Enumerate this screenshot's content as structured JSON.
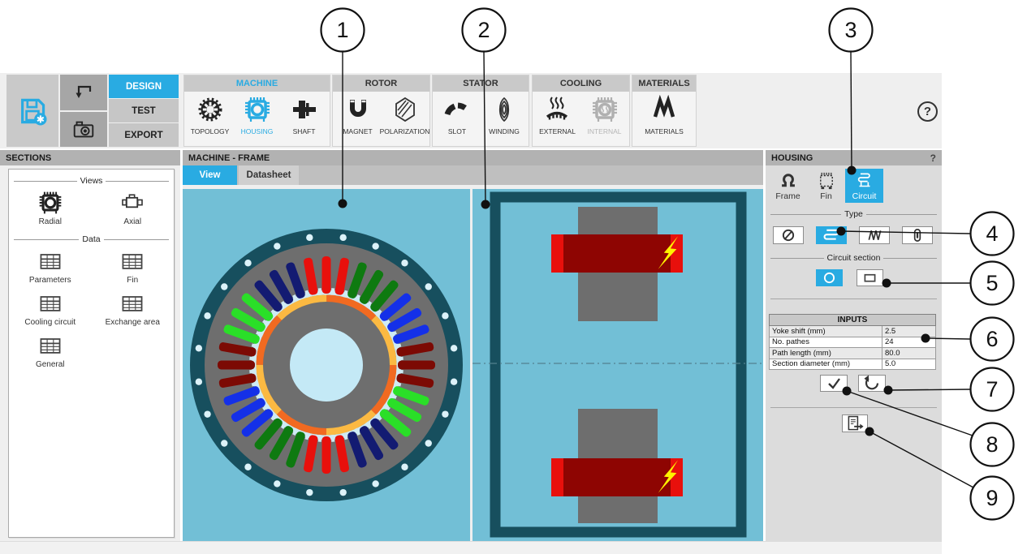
{
  "app": {
    "quick_buttons": [
      {
        "icon": "save-icon"
      },
      {
        "icon": "undo-arrow-icon"
      },
      {
        "icon": "camera-icon"
      }
    ],
    "help_label": "?"
  },
  "ribbon": {
    "file_tabs": [
      {
        "label": "DESIGN",
        "active": true
      },
      {
        "label": "TEST",
        "active": false
      },
      {
        "label": "EXPORT",
        "active": false
      }
    ],
    "groups": [
      {
        "label": "MACHINE",
        "active": true,
        "items": [
          {
            "label": "TOPOLOGY",
            "icon": "topology-icon"
          },
          {
            "label": "HOUSING",
            "icon": "housing-icon",
            "active": true
          },
          {
            "label": "SHAFT",
            "icon": "shaft-icon"
          }
        ]
      },
      {
        "label": "ROTOR",
        "items": [
          {
            "label": "MAGNET",
            "icon": "magnet-icon"
          },
          {
            "label": "POLARIZATION",
            "icon": "polarization-icon"
          }
        ]
      },
      {
        "label": "STATOR",
        "items": [
          {
            "label": "SLOT",
            "icon": "slot-icon"
          },
          {
            "label": "WINDING",
            "icon": "winding-icon"
          }
        ]
      },
      {
        "label": "COOLING",
        "items": [
          {
            "label": "EXTERNAL",
            "icon": "external-cooling-icon"
          },
          {
            "label": "INTERNAL",
            "icon": "internal-cooling-icon",
            "disabled": true
          }
        ]
      },
      {
        "label": "MATERIALS",
        "items": [
          {
            "label": "MATERIALS",
            "icon": "materials-icon"
          }
        ]
      }
    ]
  },
  "sections_panel": {
    "title": "SECTIONS",
    "views_divider": "Views",
    "data_divider": "Data",
    "views": [
      {
        "label": "Radial",
        "icon": "radial-view-icon"
      },
      {
        "label": "Axial",
        "icon": "axial-view-icon"
      }
    ],
    "data_items": [
      {
        "label": "Parameters",
        "icon": "table-icon"
      },
      {
        "label": "Fin",
        "icon": "table-icon"
      },
      {
        "label": "Cooling circuit",
        "icon": "table-icon"
      },
      {
        "label": "Exchange area",
        "icon": "table-icon"
      },
      {
        "label": "General",
        "icon": "table-icon"
      }
    ]
  },
  "main_panel": {
    "title": "MACHINE - FRAME",
    "tabs": [
      {
        "label": "View",
        "active": true
      },
      {
        "label": "Datasheet",
        "active": false
      }
    ]
  },
  "housing_panel": {
    "title": "HOUSING",
    "help_label": "?",
    "tabs": [
      {
        "label": "Frame",
        "icon": "frame-icon"
      },
      {
        "label": "Fin",
        "icon": "fin-icon"
      },
      {
        "label": "Circuit",
        "icon": "circuit-icon",
        "active": true
      }
    ],
    "type_divider": "Type",
    "type_options": [
      {
        "icon": "no-circuit-icon",
        "selected": false
      },
      {
        "icon": "serpentine-circuit-icon",
        "selected": true
      },
      {
        "icon": "wavy-circuit-icon",
        "selected": false
      },
      {
        "icon": "axial-duct-icon",
        "selected": false
      }
    ],
    "circuit_section_divider": "Circuit section",
    "section_options": [
      {
        "icon": "circle-section-icon",
        "selected": true
      },
      {
        "icon": "square-section-icon",
        "selected": false
      }
    ],
    "inputs": {
      "title": "INPUTS",
      "rows": [
        {
          "label": "Yoke shift (mm)",
          "value": "2.5"
        },
        {
          "label": "No. pathes",
          "value": "24"
        },
        {
          "label": "Path length (mm)",
          "value": "80.0"
        },
        {
          "label": "Section diameter (mm)",
          "value": "5.0"
        }
      ]
    },
    "actions": {
      "apply_icon": "check-icon",
      "reset_icon": "reset-arrow-icon",
      "export_icon": "export-document-icon"
    }
  },
  "callouts": {
    "labels": [
      "1",
      "2",
      "3",
      "4",
      "5",
      "6",
      "7",
      "8",
      "9"
    ]
  },
  "machine_views": {
    "radial": {
      "slot_count": 36,
      "slots_per_phase": 3,
      "slot_color_cycle": [
        "#E8100C",
        "#0E7A10",
        "#1430E8",
        "#7C0A04",
        "#2ADF28",
        "#131B72"
      ],
      "cooling_path_count": 24,
      "pole_count": 8,
      "colors": {
        "background": "#72BFD6",
        "housing": "#174F5E",
        "core": "#6E6E6E",
        "shaft_bore": "#C4E9F6",
        "cooling_path": "#DCF2F9",
        "air_gap": "#CFEBF4",
        "magnet_a": "#F16A21",
        "magnet_b": "#FBB942"
      }
    },
    "axial": {
      "colors": {
        "background": "#72BFD6",
        "frame": "#174F5E",
        "core": "#6E6E6E",
        "winding_end": "#E8100C",
        "winding_body": "#8E0502",
        "loss_bolt": "#FFF200",
        "centerline": "#53808F"
      }
    }
  }
}
